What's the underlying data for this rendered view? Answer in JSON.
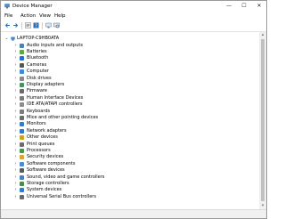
{
  "window": {
    "title": "Device Manager",
    "controls": {
      "minimize": "—",
      "maximize": "☐",
      "close": "✕"
    }
  },
  "menu": [
    "File",
    "Action",
    "View",
    "Help"
  ],
  "toolbar": {
    "buttons": [
      "back-arrow-icon",
      "forward-arrow-icon",
      "properties-icon",
      "help-icon",
      "update-driver-icon",
      "scan-hardware-icon"
    ]
  },
  "tree": {
    "root_label": "LAPTOP-C9HB0ATA",
    "items": [
      {
        "label": "Audio inputs and outputs",
        "icon": "speaker-icon",
        "color": "#4a7fc1"
      },
      {
        "label": "Batteries",
        "icon": "battery-icon",
        "color": "#5aa845"
      },
      {
        "label": "Bluetooth",
        "icon": "bluetooth-icon",
        "color": "#1e6fd8"
      },
      {
        "label": "Cameras",
        "icon": "camera-icon",
        "color": "#555555"
      },
      {
        "label": "Computer",
        "icon": "computer-icon",
        "color": "#3b8ad9"
      },
      {
        "label": "Disk drives",
        "icon": "disk-drive-icon",
        "color": "#8a8a8a"
      },
      {
        "label": "Display adapters",
        "icon": "display-adapter-icon",
        "color": "#3a9a5a"
      },
      {
        "label": "Firmware",
        "icon": "firmware-icon",
        "color": "#6a6a6a"
      },
      {
        "label": "Human Interface Devices",
        "icon": "hid-icon",
        "color": "#7a7a7a"
      },
      {
        "label": "IDE ATA/ATAPI controllers",
        "icon": "ide-controller-icon",
        "color": "#8c8c8c"
      },
      {
        "label": "Keyboards",
        "icon": "keyboard-icon",
        "color": "#7d7d7d"
      },
      {
        "label": "Mice and other pointing devices",
        "icon": "mouse-icon",
        "color": "#6d6d6d"
      },
      {
        "label": "Monitors",
        "icon": "monitor-icon",
        "color": "#2f7dd1"
      },
      {
        "label": "Network adapters",
        "icon": "network-adapter-icon",
        "color": "#2a7bd0"
      },
      {
        "label": "Other devices",
        "icon": "other-devices-icon",
        "color": "#c9a227"
      },
      {
        "label": "Print queues",
        "icon": "printer-icon",
        "color": "#6b6b6b"
      },
      {
        "label": "Processors",
        "icon": "processor-icon",
        "color": "#3c9c4c"
      },
      {
        "label": "Security devices",
        "icon": "security-device-icon",
        "color": "#d4a93a"
      },
      {
        "label": "Software components",
        "icon": "software-component-icon",
        "color": "#4b8bd6"
      },
      {
        "label": "Software devices",
        "icon": "software-device-icon",
        "color": "#5a5a5a"
      },
      {
        "label": "Sound, video and game controllers",
        "icon": "sound-controller-icon",
        "color": "#4a7fc1"
      },
      {
        "label": "Storage controllers",
        "icon": "storage-controller-icon",
        "color": "#4a8b4a"
      },
      {
        "label": "System devices",
        "icon": "system-device-icon",
        "color": "#2f7dd1"
      },
      {
        "label": "Universal Serial Bus controllers",
        "icon": "usb-controller-icon",
        "color": "#6a6a6a"
      }
    ]
  }
}
